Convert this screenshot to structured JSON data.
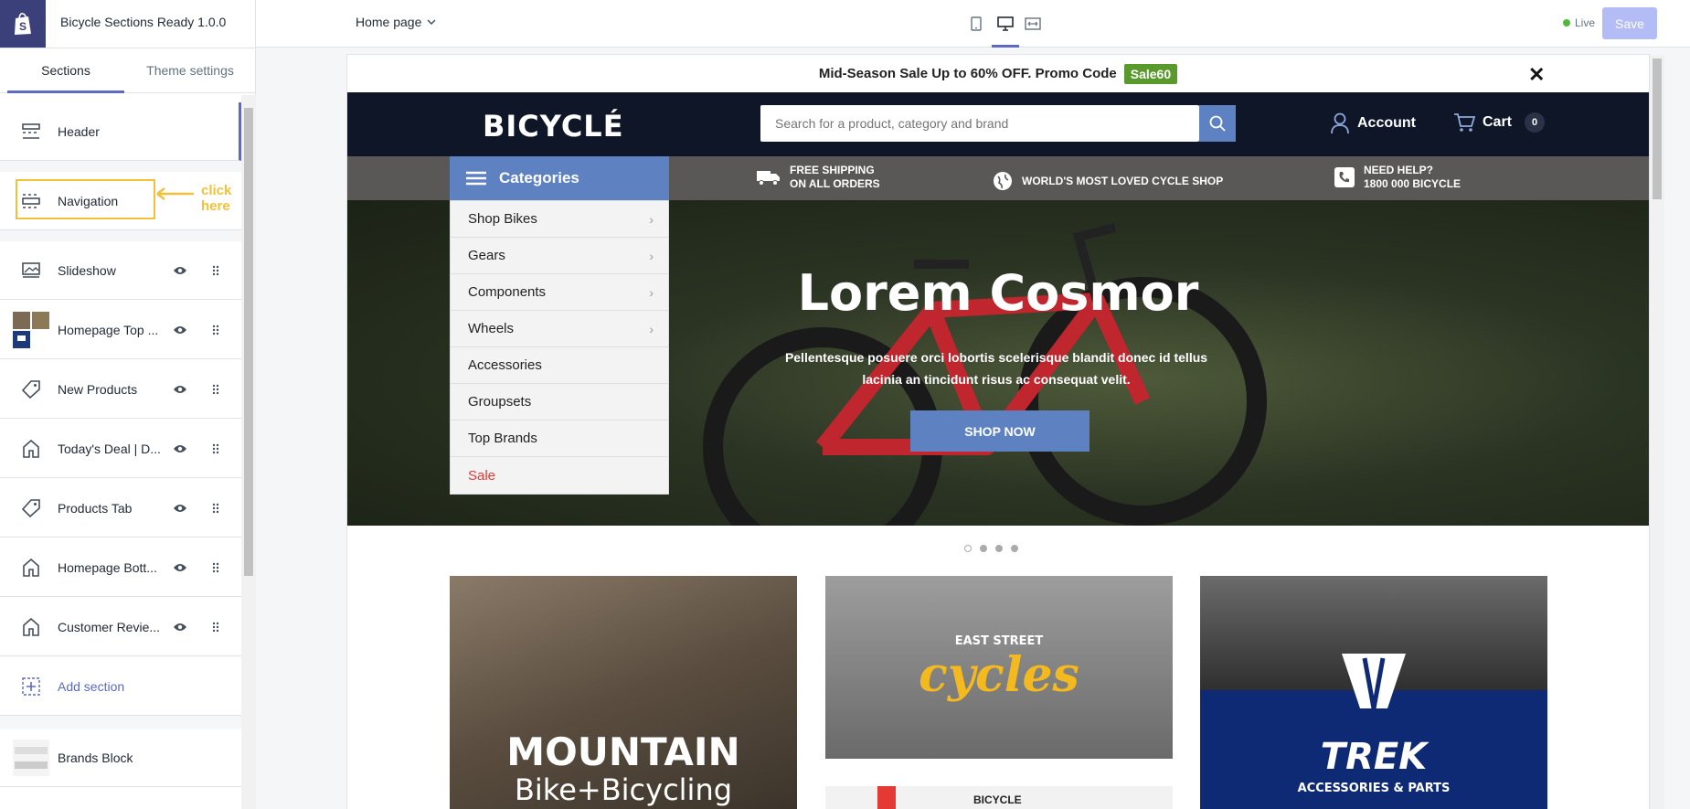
{
  "editor": {
    "theme_name": "Bicycle Sections Ready 1.0.0",
    "tabs": [
      {
        "label": "Sections"
      },
      {
        "label": "Theme settings"
      }
    ],
    "sections": [
      {
        "label": "Header",
        "icon": "header-layout-icon"
      },
      {
        "label": "Navigation",
        "icon": "header-layout-icon"
      },
      {
        "label": "Slideshow",
        "icon": "slideshow-icon"
      },
      {
        "label": "Homepage Top ...",
        "icon": "image-thumbnail-icon"
      },
      {
        "label": "New Products",
        "icon": "tag-icon"
      },
      {
        "label": "Today's Deal | D...",
        "icon": "store-icon"
      },
      {
        "label": "Products Tab",
        "icon": "tag-icon"
      },
      {
        "label": "Homepage Bott...",
        "icon": "store-icon"
      },
      {
        "label": "Customer Revie...",
        "icon": "store-icon"
      },
      {
        "label": "Add section",
        "icon": "add-section-icon"
      },
      {
        "label": "Brands Block",
        "icon": "brand-logo-thumbnail"
      }
    ],
    "annotation": "click here",
    "page_select": "Home page",
    "live_label": "Live",
    "save_label": "Save",
    "colors": {
      "accent": "#5c6ac4",
      "annotation": "#f2c13a",
      "live": "#50b83c"
    }
  },
  "store": {
    "promo_text": "Mid-Season Sale Up to 60% OFF. Promo Code",
    "promo_code": "Sale60",
    "logo": "BICYCLÉ",
    "search_placeholder": "Search for a product, category and brand",
    "account_label": "Account",
    "cart_label": "Cart",
    "cart_count": "0",
    "categories_label": "Categories",
    "info": [
      {
        "line1": "FREE SHIPPING",
        "line2": "ON ALL ORDERS",
        "icon": "truck-icon"
      },
      {
        "line1": "WORLD'S MOST LOVED CYCLE SHOP",
        "line2": "",
        "icon": "globe-icon"
      },
      {
        "line1": "NEED HELP?",
        "line2": "1800 000 BICYCLE",
        "icon": "phone-icon"
      }
    ],
    "menu": [
      {
        "label": "Shop Bikes",
        "has_sub": true
      },
      {
        "label": "Gears",
        "has_sub": true
      },
      {
        "label": "Components",
        "has_sub": true
      },
      {
        "label": "Wheels",
        "has_sub": true
      },
      {
        "label": "Accessories",
        "has_sub": false
      },
      {
        "label": "Groupsets",
        "has_sub": false
      },
      {
        "label": "Top Brands",
        "has_sub": false
      },
      {
        "label": "Sale",
        "has_sub": false
      }
    ],
    "hero": {
      "title": "Lorem Cosmor",
      "text": "Pellentesque posuere orci lobortis scelerisque blandit donec id tellus lacinia an tincidunt risus ac consequat velit.",
      "button": "SHOP NOW"
    },
    "banners": {
      "b1_line1": "MOUNTAIN",
      "b1_line2": "Bike+Bicycling",
      "b2_line1": "EAST STREET",
      "b2_line2": "cycles",
      "b3_brand": "TREK",
      "b3_sub": "ACCESSORIES & PARTS",
      "b4_label": "BICYCLE"
    },
    "colors": {
      "header_bg": "#0f1628",
      "nav_bg": "#5a5856",
      "primary": "#5e81c2",
      "promo_code_bg": "#5a9a2d",
      "sale": "#e53935"
    }
  }
}
